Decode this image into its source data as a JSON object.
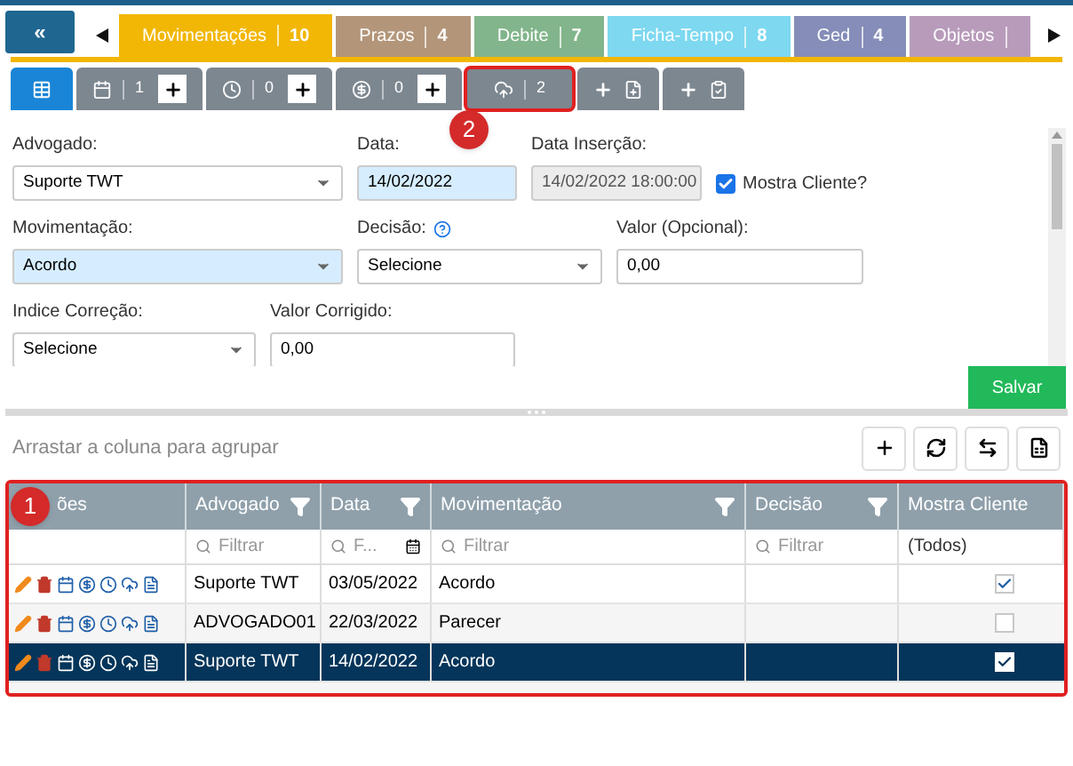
{
  "back_button": {
    "label": "«"
  },
  "tabs": [
    {
      "label": "Movimentações",
      "count": "10",
      "color": "#f2b705",
      "selected": true
    },
    {
      "label": "Prazos",
      "count": "4",
      "color": "#b3967a",
      "selected": false
    },
    {
      "label": "Debite",
      "count": "7",
      "color": "#82b58b",
      "selected": false
    },
    {
      "label": "Ficha-Tempo",
      "count": "8",
      "color": "#7dd8f0",
      "selected": false
    },
    {
      "label": "Ged",
      "count": "4",
      "color": "#858db8",
      "selected": false
    },
    {
      "label": "Objetos",
      "color": "#b89bbb",
      "selected": false
    }
  ],
  "subtabs": [
    {
      "kind": "grid",
      "selected": true
    },
    {
      "kind": "calendar",
      "count": "1",
      "add": true,
      "selected": false
    },
    {
      "kind": "clock",
      "count": "0",
      "add": true,
      "selected": false
    },
    {
      "kind": "money",
      "count": "0",
      "add": true,
      "selected": false
    },
    {
      "kind": "cloud",
      "count": "2",
      "add": false,
      "selected": false,
      "callout": "2"
    },
    {
      "kind": "add-doc",
      "selected": false
    },
    {
      "kind": "add-clipboard",
      "selected": false
    }
  ],
  "form": {
    "rows": [
      [
        {
          "kind": "select",
          "label": "Advogado:",
          "value": "Suporte TWT",
          "focused": false
        },
        {
          "kind": "input",
          "label": "Data:",
          "value": "14/02/2022",
          "focused": true
        },
        {
          "kind": "readonly",
          "label": "Data Inserção:",
          "value": "14/02/2022 18:00:00"
        },
        {
          "kind": "checkbox",
          "label": "Mostra Cliente?",
          "checked": true
        }
      ],
      [
        {
          "kind": "select",
          "label": "Movimentação:",
          "value": "Acordo",
          "focused": true
        },
        {
          "kind": "select",
          "label": "Decisão:",
          "value": "Selecione",
          "focused": false,
          "help": true
        },
        {
          "kind": "input",
          "label": "Valor (Opcional):",
          "value": "0,00",
          "focused": false
        }
      ],
      [
        {
          "kind": "select",
          "label": "Indice Correção:",
          "value": "Selecione",
          "focused": false
        },
        {
          "kind": "input",
          "label": "Valor Corrigido:",
          "value": "0,00",
          "focused": false
        }
      ]
    ],
    "save_button": "Salvar"
  },
  "group_hint": "Arrastar a coluna para agrupar",
  "toolbar": [
    {
      "kind": "add"
    },
    {
      "kind": "refresh"
    },
    {
      "kind": "swap"
    },
    {
      "kind": "export"
    }
  ],
  "grid": {
    "callout": "1",
    "columns": [
      {
        "label": "ões",
        "filter": false
      },
      {
        "label": "Advogado",
        "filter": true
      },
      {
        "label": "Data",
        "filter": true
      },
      {
        "label": "Movimentação",
        "filter": true
      },
      {
        "label": "Decisão",
        "filter": true
      },
      {
        "label": "Mostra Cliente",
        "filter": false
      }
    ],
    "filters": [
      {
        "kind": "none"
      },
      {
        "kind": "search",
        "placeholder": "Filtrar"
      },
      {
        "kind": "date",
        "placeholder": "F..."
      },
      {
        "kind": "search",
        "placeholder": "Filtrar"
      },
      {
        "kind": "search",
        "placeholder": "Filtrar"
      },
      {
        "kind": "text",
        "value": "(Todos)"
      }
    ],
    "rows": [
      {
        "advogado": "Suporte TWT",
        "data": "03/05/2022",
        "movimentacao": "Acordo",
        "decisao": "",
        "mostra_cliente": true,
        "selected": false
      },
      {
        "advogado": "ADVOGADO01",
        "data": "22/03/2022",
        "movimentacao": "Parecer",
        "decisao": "",
        "mostra_cliente": false,
        "selected": false
      },
      {
        "advogado": "Suporte TWT",
        "data": "14/02/2022",
        "movimentacao": "Acordo",
        "decisao": "",
        "mostra_cliente": true,
        "selected": true
      }
    ]
  }
}
